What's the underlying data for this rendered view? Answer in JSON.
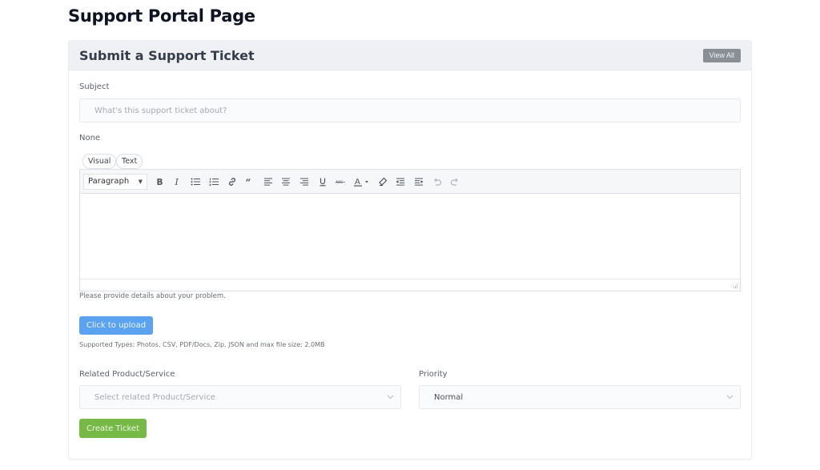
{
  "page": {
    "title": "Support Portal Page"
  },
  "card": {
    "title": "Submit a Support Ticket",
    "view_all_label": "View All"
  },
  "form": {
    "subject": {
      "label": "Subject",
      "value": "",
      "placeholder": "What's this support ticket about?"
    },
    "details": {
      "label": "None",
      "tabs": [
        {
          "label": "Visual",
          "active": true
        },
        {
          "label": "Text",
          "active": false
        }
      ],
      "format_select": "Paragraph",
      "toolbar_icons": [
        "bold-icon",
        "italic-icon",
        "bullet-list-icon",
        "numbered-list-icon",
        "link-icon",
        "blockquote-icon",
        "align-left-icon",
        "align-center-icon",
        "align-right-icon",
        "underline-icon",
        "strikethrough-icon",
        "text-color-icon",
        "clear-formatting-icon",
        "outdent-icon",
        "indent-icon",
        "undo-icon",
        "redo-icon"
      ],
      "content": "",
      "help": "Please provide details about your problem."
    },
    "upload": {
      "button_label": "Click to upload",
      "help": "Supported Types: Photos, CSV, PDF/Docs, Zip, JSON and max file size: 2.0MB"
    },
    "product": {
      "label": "Related Product/Service",
      "placeholder": "Select related Product/Service",
      "value": ""
    },
    "priority": {
      "label": "Priority",
      "value": "Normal"
    },
    "submit_label": "Create Ticket"
  },
  "colors": {
    "upload_button": "#5ba3f0",
    "create_button": "#76b947",
    "view_all_button": "#8a8e95",
    "header_bg": "#eef0f4"
  }
}
